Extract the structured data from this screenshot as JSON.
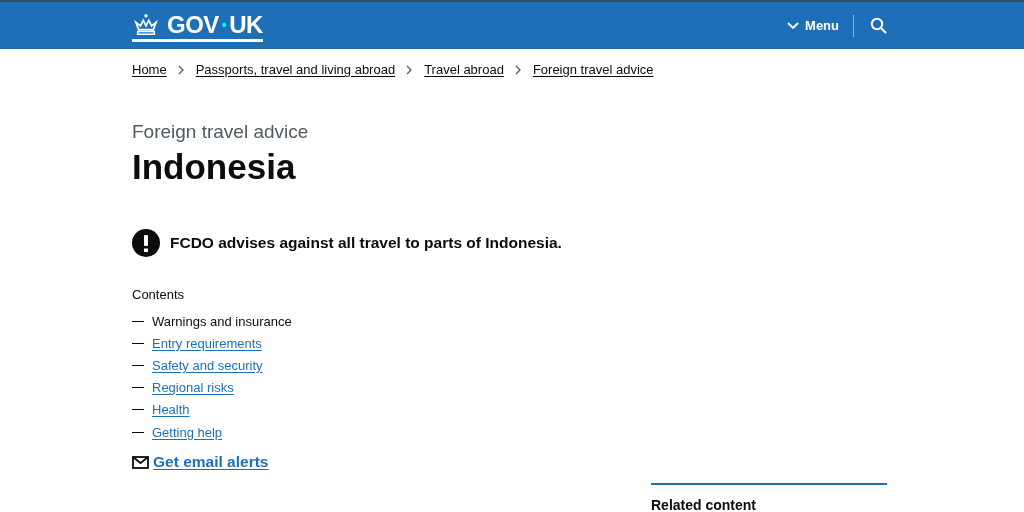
{
  "header": {
    "logo": {
      "left": "GOV",
      "separator": "•",
      "right": "UK"
    },
    "menu_button": "Menu"
  },
  "breadcrumbs": [
    "Home",
    "Passports, travel and living abroad",
    "Travel abroad",
    "Foreign travel advice"
  ],
  "caption": "Foreign travel advice",
  "title": "Indonesia",
  "warning": "FCDO advises against all travel to parts of Indonesia.",
  "contents": {
    "heading": "Contents",
    "items": [
      {
        "label": "Warnings and insurance",
        "selected": true
      },
      {
        "label": "Entry requirements",
        "selected": false
      },
      {
        "label": "Safety and security",
        "selected": false
      },
      {
        "label": "Regional risks",
        "selected": false
      },
      {
        "label": "Health",
        "selected": false
      },
      {
        "label": "Getting help",
        "selected": false
      }
    ]
  },
  "email_alerts": "Get email alerts",
  "related": {
    "heading": "Related content"
  }
}
